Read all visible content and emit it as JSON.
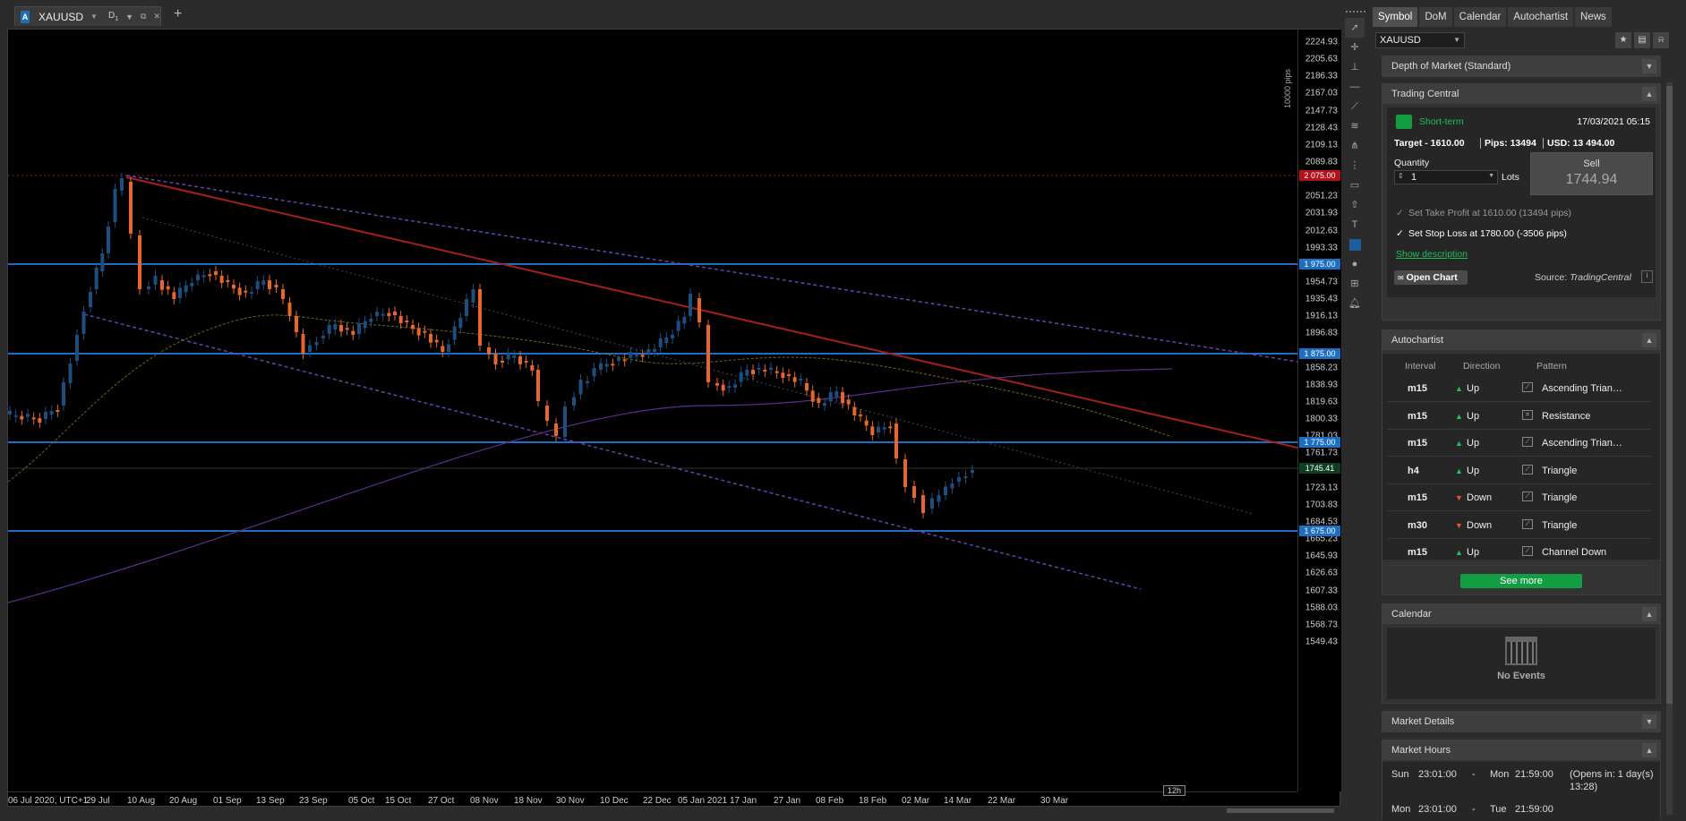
{
  "tab": {
    "badge": "A",
    "symbol": "XAUUSD",
    "timeframe": "D",
    "tf_sub": "1"
  },
  "chart": {
    "pips_label": "10000 pips",
    "bottom_tag": "12h",
    "y_labels": [
      "2224.93",
      "2205.63",
      "2186.33",
      "2167.03",
      "2147.73",
      "2128.43",
      "2109.13",
      "2089.83",
      "2051.23",
      "2031.93",
      "2012.63",
      "1993.33",
      "1954.73",
      "1935.43",
      "1916.13",
      "1896.83",
      "1858.23",
      "1838.93",
      "1819.63",
      "1800.33",
      "1781.03",
      "1761.73",
      "1723.13",
      "1703.83",
      "1684.53",
      "1665.23",
      "1645.93",
      "1626.63",
      "1607.33",
      "1588.03",
      "1568.73",
      "1549.43"
    ],
    "tags": [
      {
        "text": "2 075.00",
        "color": "#b3121b"
      },
      {
        "text": "1 975.00",
        "color": "#1c6fc2"
      },
      {
        "text": "1 875.00",
        "color": "#1c6fc2"
      },
      {
        "text": "1 775.00",
        "color": "#1c6fc2"
      },
      {
        "text": "1745.41",
        "color": "#0f3f23"
      },
      {
        "text": "1 675.00",
        "color": "#1c6fc2"
      }
    ],
    "x_labels": [
      "06 Jul 2020, UTC+1",
      "29 Jul",
      "10 Aug",
      "20 Aug",
      "01 Sep",
      "13 Sep",
      "23 Sep",
      "05 Oct",
      "15 Oct",
      "27 Oct",
      "08 Nov",
      "18 Nov",
      "30 Nov",
      "10 Dec",
      "22 Dec",
      "05 Jan 2021",
      "17 Jan",
      "27 Jan",
      "08 Feb",
      "18 Feb",
      "02 Mar",
      "14 Mar",
      "22 Mar",
      "30 Mar"
    ]
  },
  "panel": {
    "tabs": [
      "Symbol",
      "DoM",
      "Calendar",
      "Autochartist",
      "News"
    ],
    "symbol": "XAUUSD",
    "dom_title": "Depth of Market (Standard)",
    "tc": {
      "title": "Trading Central",
      "term": "Short-term",
      "date": "17/03/2021 05:15",
      "target": "Target - 1610.00",
      "pips": "Pips: 13494",
      "usd": "USD: 13 494.00",
      "qty_label": "Quantity",
      "qty": "1",
      "lots": "Lots",
      "sell_label": "Sell",
      "sell_price": "1744.94",
      "tp": "Set Take Profit at 1610.00 (13494 pips)",
      "sl": "Set Stop Loss at 1780.00 (-3506 pips)",
      "show_desc": "Show description",
      "open_chart": "Open Chart",
      "source": "Source:",
      "source_name": "TradingCentral"
    },
    "ac": {
      "title": "Autochartist",
      "headers": [
        "Interval",
        "Direction",
        "Pattern"
      ],
      "rows": [
        {
          "interval": "m15",
          "dir": "Up",
          "pattern": "Ascending Trian…"
        },
        {
          "interval": "m15",
          "dir": "Up",
          "pattern": "Resistance"
        },
        {
          "interval": "m15",
          "dir": "Up",
          "pattern": "Ascending Trian…"
        },
        {
          "interval": "h4",
          "dir": "Up",
          "pattern": "Triangle"
        },
        {
          "interval": "m15",
          "dir": "Down",
          "pattern": "Triangle"
        },
        {
          "interval": "m30",
          "dir": "Down",
          "pattern": "Triangle"
        },
        {
          "interval": "m15",
          "dir": "Up",
          "pattern": "Channel Down"
        }
      ],
      "see_more": "See more"
    },
    "cal": {
      "title": "Calendar",
      "no_events": "No Events"
    },
    "market_details": "Market Details",
    "hours": {
      "title": "Market Hours",
      "rows": [
        {
          "d1": "Sun",
          "t1": "23:01:00",
          "sep": "-",
          "d2": "Mon",
          "t2": "21:59:00",
          "note": "(Opens in: 1 day(s)",
          "note2": "13:28)"
        },
        {
          "d1": "Mon",
          "t1": "23:01:00",
          "sep": "-",
          "d2": "Tue",
          "t2": "21:59:00",
          "note": "",
          "note2": ""
        }
      ]
    }
  }
}
